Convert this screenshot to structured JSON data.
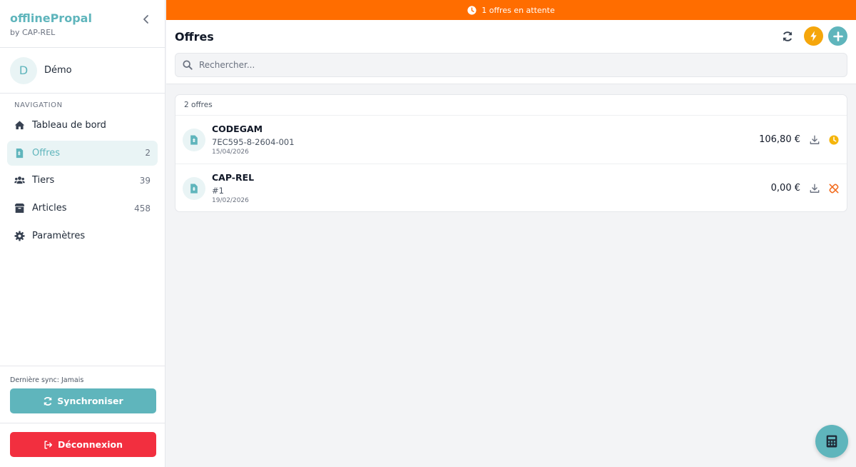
{
  "app": {
    "name": "offlinePropal",
    "subtitle": "by CAP-REL"
  },
  "user": {
    "initial": "D",
    "name": "Démo"
  },
  "nav": {
    "title": "NAVIGATION",
    "items": [
      {
        "label": "Tableau de bord",
        "count": "",
        "icon": "home-icon"
      },
      {
        "label": "Offres",
        "count": "2",
        "icon": "file-invoice-icon"
      },
      {
        "label": "Tiers",
        "count": "39",
        "icon": "users-icon"
      },
      {
        "label": "Articles",
        "count": "458",
        "icon": "box-icon"
      },
      {
        "label": "Paramètres",
        "count": "",
        "icon": "gear-icon"
      }
    ]
  },
  "sync": {
    "last_label": "Dernière sync: Jamais",
    "button": "Synchroniser"
  },
  "logout": {
    "button": "Déconnexion"
  },
  "banner": {
    "text": "1 offres en attente"
  },
  "header": {
    "title": "Offres"
  },
  "search": {
    "placeholder": "Rechercher..."
  },
  "list": {
    "count_label": "2 offres",
    "rows": [
      {
        "title": "CODEGAM",
        "ref": "7EC595-8-2604-001",
        "date": "15/04/2026",
        "amount": "106,80 €",
        "status": "pending-clock-icon"
      },
      {
        "title": "CAP-REL",
        "ref": "#1",
        "date": "19/02/2026",
        "amount": "0,00 €",
        "status": "unlinked-icon"
      }
    ]
  },
  "colors": {
    "accent": "#5fb5bc",
    "banner": "#ff6d00",
    "bolt": "#f5a60c",
    "logout": "#f22f3f",
    "pending": "#f5b50c",
    "unlinked": "#f26b1d"
  }
}
